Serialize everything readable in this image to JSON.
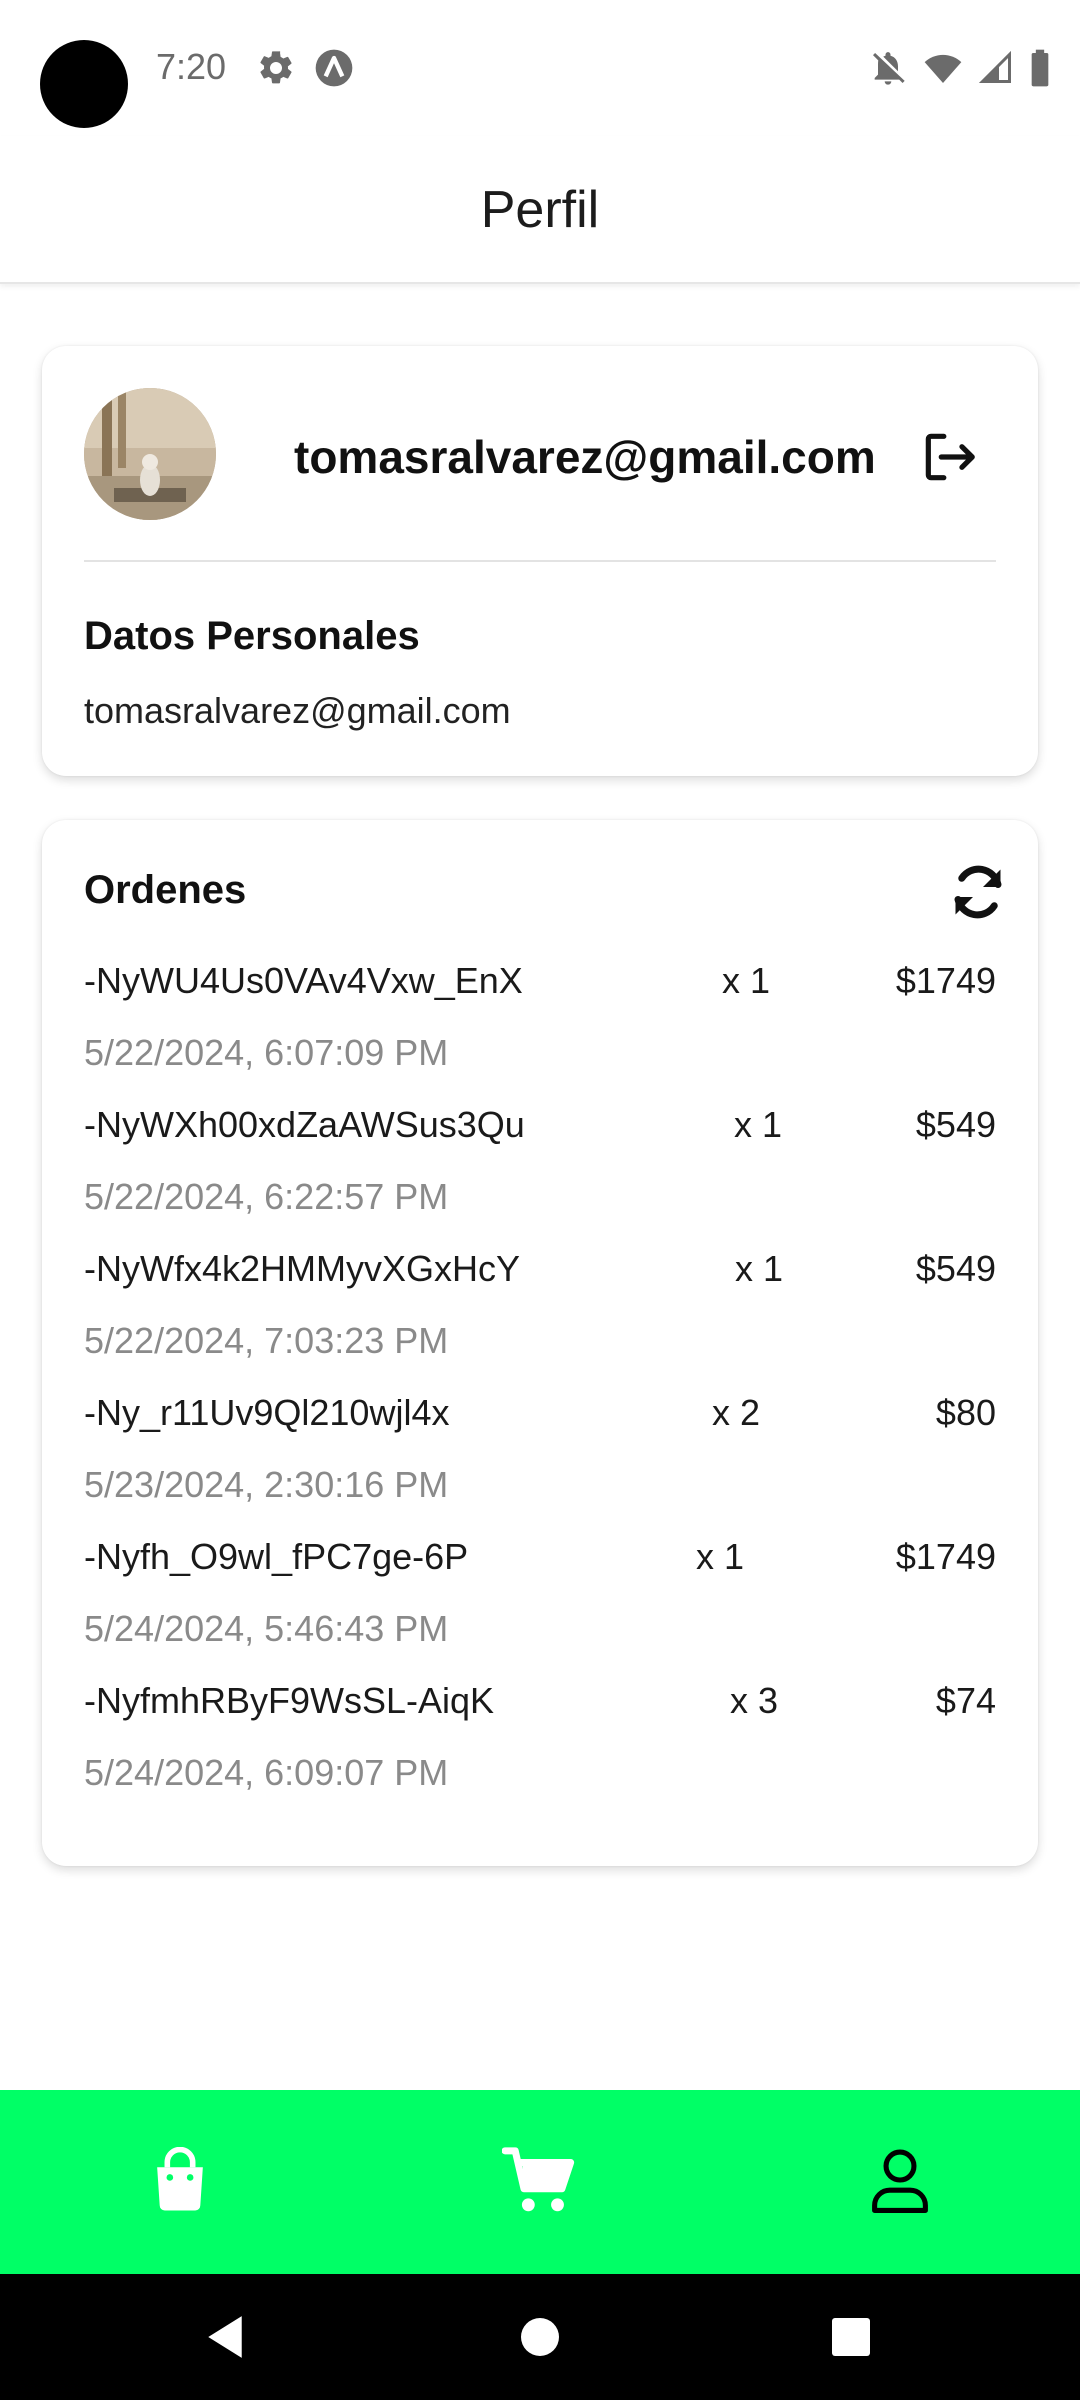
{
  "status_bar": {
    "time": "7:20",
    "icons_left": [
      "settings-icon",
      "app-notification-icon"
    ],
    "icons_right": [
      "notifications-off-icon",
      "wifi-icon",
      "signal-icon",
      "battery-icon"
    ]
  },
  "header": {
    "title": "Perfil"
  },
  "profile": {
    "email_display": "tomasralvarez@gmail.com",
    "personal_title": "Datos Personales",
    "personal_email": "tomasralvarez@gmail.com",
    "logout_icon": "logout-icon"
  },
  "orders": {
    "title": "Ordenes",
    "refresh_icon": "refresh-icon",
    "items": [
      {
        "id": "-NyWU4Us0VAv4Vxw_EnX",
        "qty": "x 1",
        "price": "$1749",
        "date": "5/22/2024, 6:07:09 PM"
      },
      {
        "id": "-NyWXh00xdZaAWSus3Qu",
        "qty": "x 1",
        "price": "$549",
        "date": "5/22/2024, 6:22:57 PM"
      },
      {
        "id": "-NyWfx4k2HMMyvXGxHcY",
        "qty": "x 1",
        "price": "$549",
        "date": "5/22/2024, 7:03:23 PM"
      },
      {
        "id": "-Ny_r11Uv9Ql210wjl4x",
        "qty": "x 2",
        "price": "$80",
        "date": "5/23/2024, 2:30:16 PM"
      },
      {
        "id": "-Nyfh_O9wl_fPC7ge-6P",
        "qty": "x 1",
        "price": "$1749",
        "date": "5/24/2024, 5:46:43 PM"
      },
      {
        "id": "-NyfmhRByF9WsSL-AiqK",
        "qty": "x 3",
        "price": "$74",
        "date": "5/24/2024, 6:09:07 PM"
      }
    ]
  },
  "bottom_nav": {
    "background": "#00ff66",
    "items": [
      {
        "icon": "shopping-bag-icon",
        "active": false
      },
      {
        "icon": "cart-icon",
        "active": false
      },
      {
        "icon": "user-icon",
        "active": true
      }
    ]
  },
  "system_nav": {
    "icons": [
      "back-icon",
      "home-icon",
      "recent-apps-icon"
    ]
  }
}
